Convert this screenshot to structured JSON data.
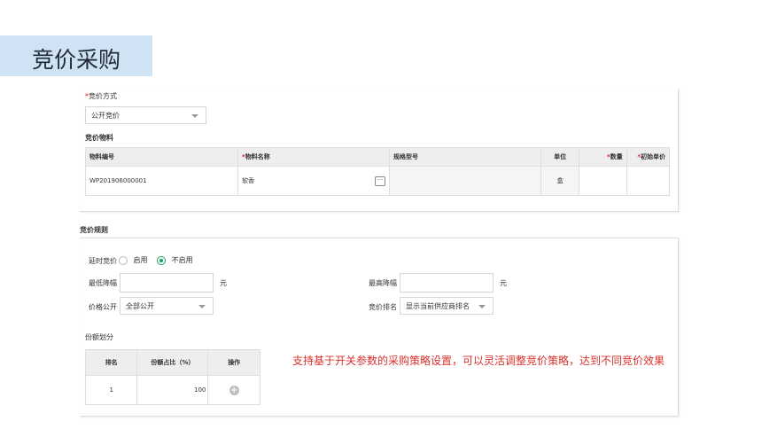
{
  "page_title": "竞价采购",
  "form": {
    "bid_method": {
      "required_mark": "*",
      "label": "竞价方式",
      "value": "公开竞价"
    },
    "material_section_title": "竞价物料",
    "material_table": {
      "headers": [
        {
          "req": "",
          "text": "物料编号"
        },
        {
          "req": "*",
          "text": "物料名称"
        },
        {
          "req": "",
          "text": "规格型号"
        },
        {
          "req": "",
          "text": "单位"
        },
        {
          "req": "*",
          "text": "数量"
        },
        {
          "req": "*",
          "text": "初始单价"
        }
      ],
      "rows": [
        {
          "code": "WP201906000001",
          "name": "软香",
          "spec": "",
          "unit": "盒",
          "qty": "",
          "price": ""
        }
      ]
    }
  },
  "rules": {
    "section_title": "竞价规则",
    "delay_label": "延时竞价",
    "delay_options": {
      "enable": "启用",
      "disable": "不启用",
      "selected": "disable"
    },
    "min_drop_label": "最低降幅",
    "max_drop_label": "最高降幅",
    "unit_yuan": "元",
    "price_public_label": "价格公开",
    "price_public_value": "全部公开",
    "rank_label": "竞价排名",
    "rank_value": "显示当前供应商排名",
    "share_label": "份额划分",
    "share_table": {
      "headers": [
        "排名",
        "份额占比（%）",
        "操作"
      ],
      "rows": [
        {
          "rank": "1",
          "share": "100"
        }
      ]
    }
  },
  "annotation": "支持基于开关参数的采购策略设置，可以灵活调整竞价策略，达到不同竞价效果"
}
